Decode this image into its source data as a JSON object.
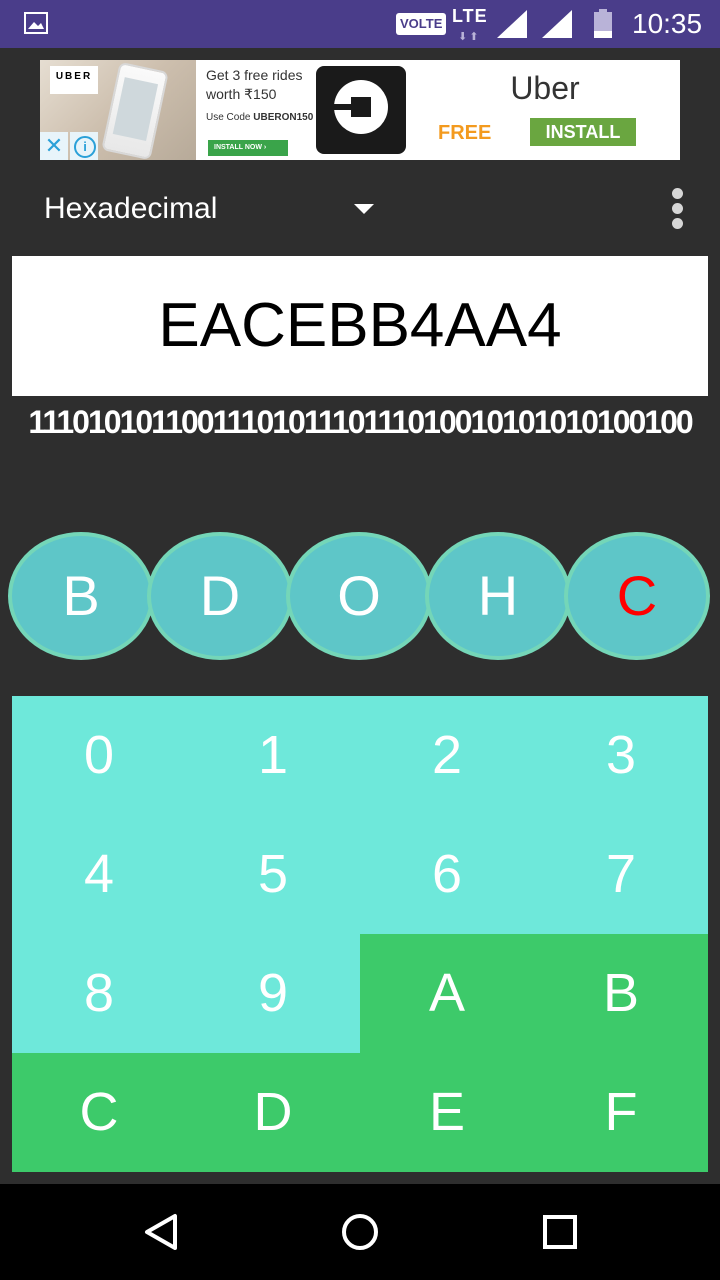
{
  "status_bar": {
    "volte": "VOLTE",
    "network": "LTE",
    "network_arrows": "⬇⬆",
    "time": "10:35",
    "icons": [
      "gallery-icon",
      "signal-icon",
      "signal-icon",
      "battery-icon"
    ]
  },
  "ad": {
    "brand_logo": "UBER",
    "line1": "Get 3 free rides",
    "line2": "worth ₹150",
    "code_prefix": "Use Code ",
    "code": "UBERON150",
    "install_small": "INSTALL NOW ›",
    "title": "Uber",
    "price": "FREE",
    "install": "INSTALL",
    "close_glyph": "✕",
    "info_glyph": "i",
    "colors": {
      "free": "#f39a1e",
      "install": "#6aa640"
    }
  },
  "toolbar": {
    "mode_selected": "Hexadecimal"
  },
  "display": {
    "value": "EACEBB4AA4",
    "binary": "1110101011001110101110111010010101010100100"
  },
  "mode_buttons": {
    "binary": "B",
    "decimal": "D",
    "octal": "O",
    "hex": "H",
    "clear": "C"
  },
  "keypad": {
    "k0": "0",
    "k1": "1",
    "k2": "2",
    "k3": "3",
    "k4": "4",
    "k5": "5",
    "k6": "6",
    "k7": "7",
    "k8": "8",
    "k9": "9",
    "kA": "A",
    "kB": "B",
    "kC": "C",
    "kD": "D",
    "kE": "E",
    "kF": "F"
  },
  "colors": {
    "status_bar": "#4a3d8a",
    "background": "#2e2e2e",
    "key_light": "#6ee8da",
    "key_dark": "#3dca6a",
    "mode_button": "#5ec6c8",
    "clear_text": "#ff0000"
  }
}
